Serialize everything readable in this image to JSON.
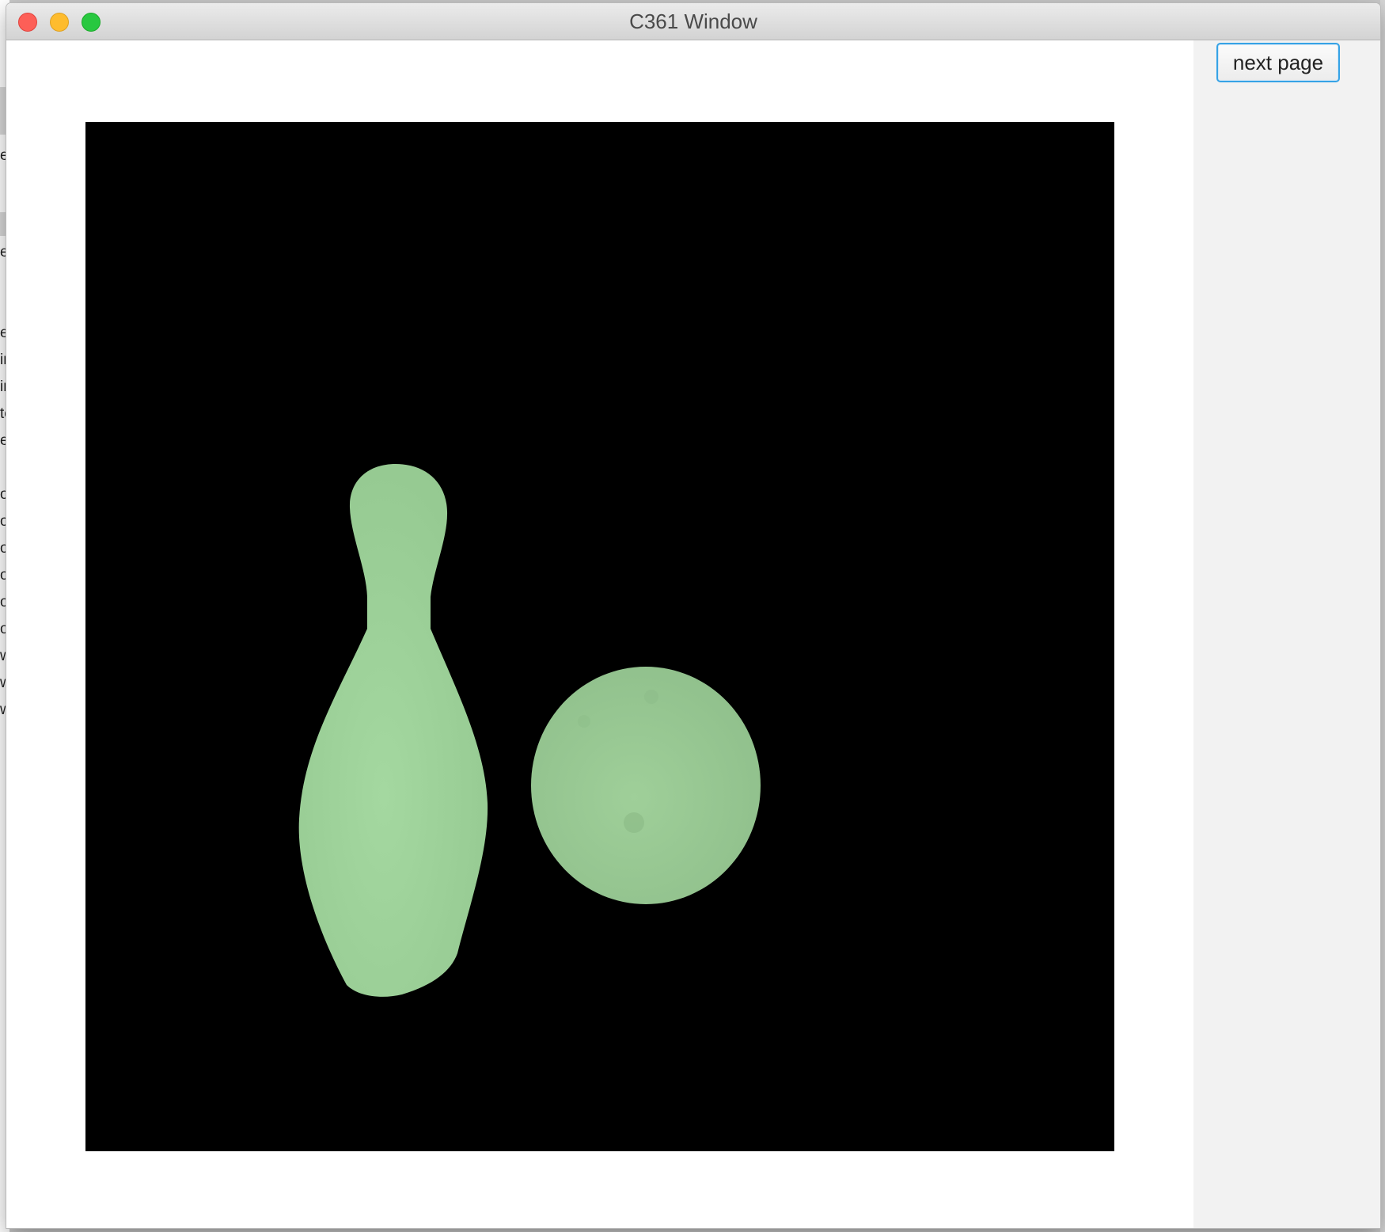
{
  "window": {
    "title": "C361 Window"
  },
  "toolbar": {
    "next_page_label": "next page"
  },
  "background_app": {
    "fragments": [
      "e",
      "e",
      "er",
      "ir",
      "ir",
      "te",
      "et",
      "ov",
      "ov",
      "ov",
      "ov",
      "ov",
      "or",
      "w",
      "w",
      "w"
    ]
  },
  "scene": {
    "background_color": "#000000",
    "object_color": "#a0d49d",
    "objects": [
      "bowling-pin",
      "bowling-ball"
    ]
  }
}
